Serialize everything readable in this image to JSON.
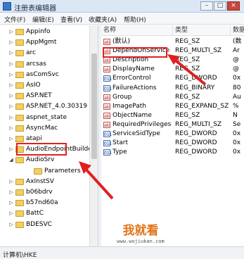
{
  "window": {
    "title": "注册表编辑器",
    "minimize": "–",
    "maximize": "□",
    "close": "×"
  },
  "menu": [
    "文件(F)",
    "编辑(E)",
    "查看(V)",
    "收藏夹(A)",
    "帮助(H)"
  ],
  "tree": {
    "items": [
      {
        "label": "Appinfo",
        "expand": "▷"
      },
      {
        "label": "AppMgmt",
        "expand": "▷"
      },
      {
        "label": "arc",
        "expand": "▷"
      },
      {
        "label": "arcsas",
        "expand": "▷"
      },
      {
        "label": "asComSvc",
        "expand": "▷"
      },
      {
        "label": "AsIO",
        "expand": "▷"
      },
      {
        "label": "ASP.NET",
        "expand": "▷"
      },
      {
        "label": "ASP.NET_4.0.30319",
        "expand": "▷"
      },
      {
        "label": "aspnet_state",
        "expand": "▷"
      },
      {
        "label": "AsyncMac",
        "expand": "▷"
      },
      {
        "label": "atapi",
        "expand": "▷"
      },
      {
        "label": "AudioEndpointBuilde",
        "expand": "▷"
      },
      {
        "label": "AudioSrv",
        "expand": "◢"
      },
      {
        "label": "Parameters",
        "expand": ""
      },
      {
        "label": "AxInstSV",
        "expand": "▷"
      },
      {
        "label": "b06bdrv",
        "expand": "▷"
      },
      {
        "label": "b57nd60a",
        "expand": "▷"
      },
      {
        "label": "BattC",
        "expand": "▷"
      },
      {
        "label": "BDESVC",
        "expand": "▷"
      }
    ]
  },
  "list": {
    "headers": {
      "name": "名称",
      "type": "类型",
      "data": "数据"
    },
    "rows": [
      {
        "icon": "ab",
        "name": "(默认)",
        "type": "REG_SZ",
        "data": "(数"
      },
      {
        "icon": "ab",
        "name": "DependOnService",
        "type": "REG_MULTI_SZ",
        "data": "Ar"
      },
      {
        "icon": "ab",
        "name": "Description",
        "type": "REG_SZ",
        "data": "@"
      },
      {
        "icon": "ab",
        "name": "DisplayName",
        "type": "REG_SZ",
        "data": "@"
      },
      {
        "icon": "bin",
        "name": "ErrorControl",
        "type": "REG_DWORD",
        "data": "0x"
      },
      {
        "icon": "bin",
        "name": "FailureActions",
        "type": "REG_BINARY",
        "data": "80"
      },
      {
        "icon": "ab",
        "name": "Group",
        "type": "REG_SZ",
        "data": "Au"
      },
      {
        "icon": "ab",
        "name": "ImagePath",
        "type": "REG_EXPAND_SZ",
        "data": "%"
      },
      {
        "icon": "ab",
        "name": "ObjectName",
        "type": "REG_SZ",
        "data": "N"
      },
      {
        "icon": "ab",
        "name": "RequiredPrivileges",
        "type": "REG_MULTI_SZ",
        "data": "Se"
      },
      {
        "icon": "bin",
        "name": "ServiceSidType",
        "type": "REG_DWORD",
        "data": "0x"
      },
      {
        "icon": "bin",
        "name": "Start",
        "type": "REG_DWORD",
        "data": "0x"
      },
      {
        "icon": "bin",
        "name": "Type",
        "type": "REG_DWORD",
        "data": "0x"
      }
    ]
  },
  "status": "计算机\\HKE",
  "watermark": {
    "big": "我就看",
    "small": "www.wojiukan.com"
  },
  "colors": {
    "annotation": "#e02020",
    "folder": "#f2cf62",
    "watermark": "#e0751c"
  }
}
